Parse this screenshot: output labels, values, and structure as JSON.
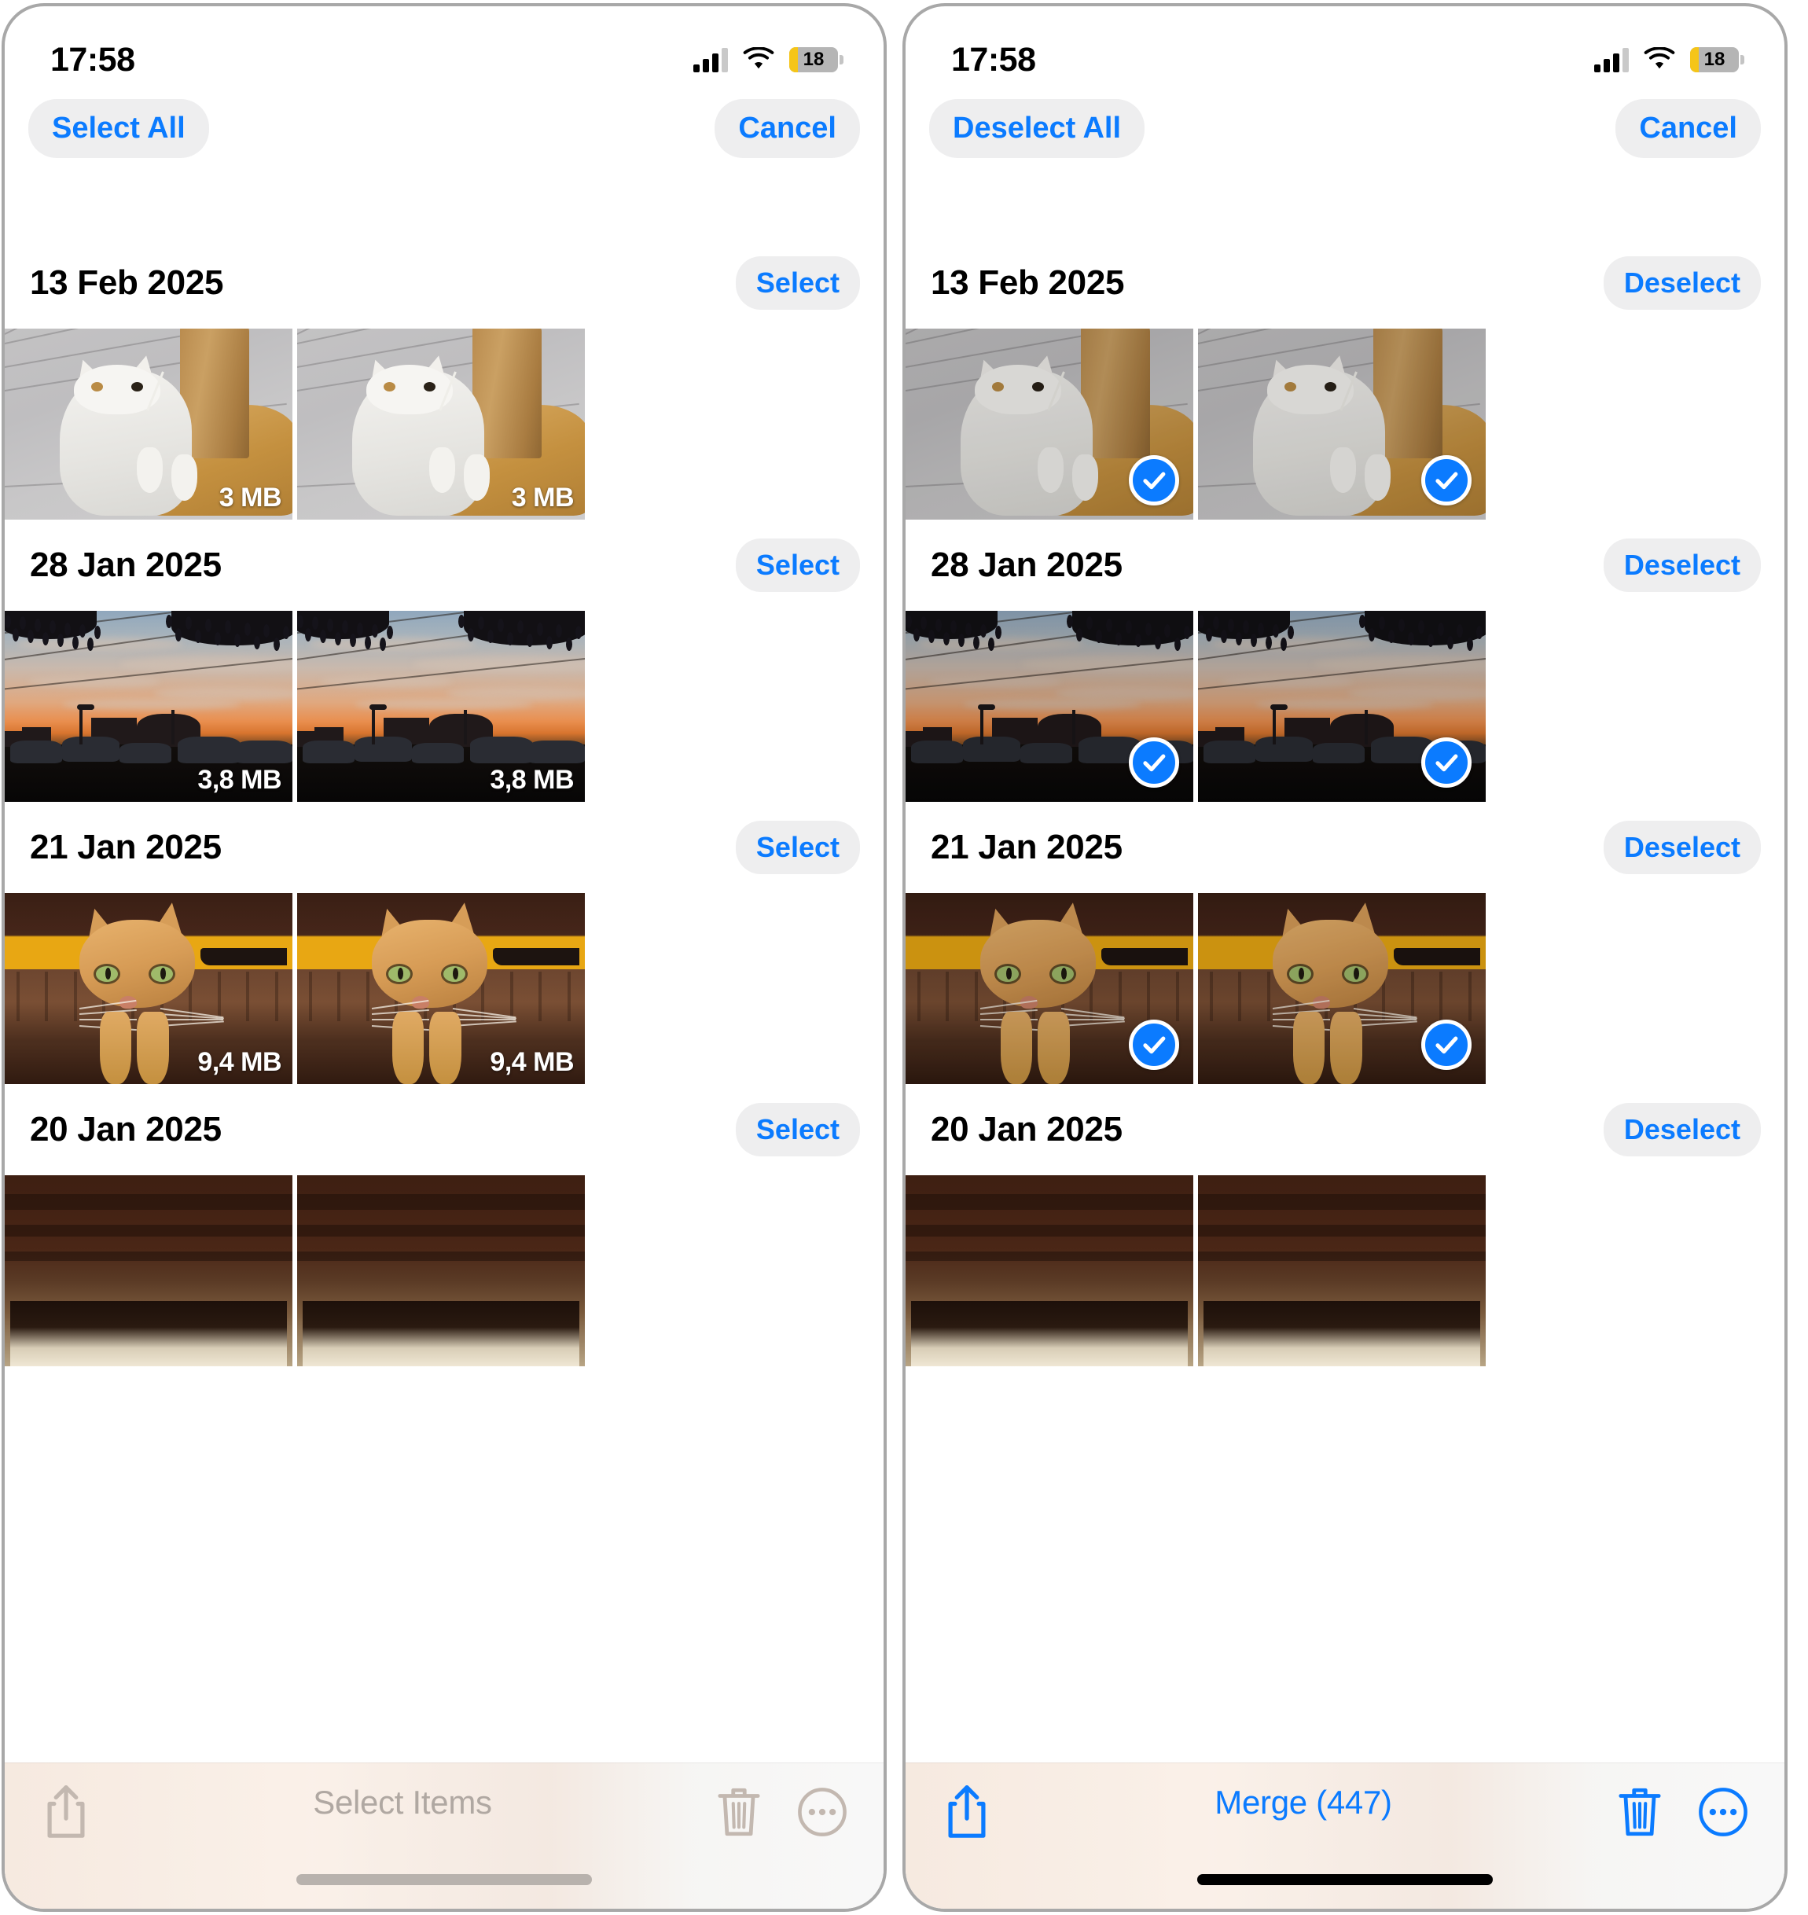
{
  "colors": {
    "accent_blue": "#0b7bff",
    "pill_bg": "#eeeeef",
    "disabled_gray": "#b0a8a2",
    "battery_yellow": "#f5c518"
  },
  "panels": [
    {
      "id": "left",
      "status": {
        "time": "17:58",
        "battery_level": "18",
        "signal_icon": "cellular-signal-icon",
        "wifi_icon": "wifi-icon",
        "battery_icon": "battery-icon"
      },
      "nav": {
        "left_button": "Select All",
        "right_button": "Cancel"
      },
      "sections": [
        {
          "date": "13 Feb 2025",
          "action_label": "Select",
          "selected": false,
          "photo": "white-kitten-on-floor",
          "items": [
            {
              "size": "3 MB",
              "selected": false
            },
            {
              "size": "3 MB",
              "selected": false
            }
          ]
        },
        {
          "date": "28 Jan 2025",
          "action_label": "Select",
          "selected": false,
          "photo": "sunset-parking-lot",
          "items": [
            {
              "size": "3,8 MB",
              "selected": false
            },
            {
              "size": "3,8 MB",
              "selected": false
            }
          ]
        },
        {
          "date": "21 Jan 2025",
          "action_label": "Select",
          "selected": false,
          "photo": "ginger-cat",
          "items": [
            {
              "size": "9,4 MB",
              "selected": false
            },
            {
              "size": "9,4 MB",
              "selected": false
            }
          ]
        },
        {
          "date": "20 Jan 2025",
          "action_label": "Select",
          "selected": false,
          "photo": "dark-wood-partial",
          "items": [
            {
              "size": "",
              "selected": false
            },
            {
              "size": "",
              "selected": false
            }
          ]
        }
      ],
      "toolbar": {
        "state": "disabled",
        "share_icon": "share-icon",
        "label": "Select Items",
        "trash_icon": "trash-icon",
        "more_icon": "more-circle-icon"
      }
    },
    {
      "id": "right",
      "status": {
        "time": "17:58",
        "battery_level": "18",
        "signal_icon": "cellular-signal-icon",
        "wifi_icon": "wifi-icon",
        "battery_icon": "battery-icon"
      },
      "nav": {
        "left_button": "Deselect All",
        "right_button": "Cancel"
      },
      "sections": [
        {
          "date": "13 Feb 2025",
          "action_label": "Deselect",
          "selected": true,
          "photo": "white-kitten-on-floor",
          "items": [
            {
              "size": "",
              "selected": true
            },
            {
              "size": "",
              "selected": true
            }
          ]
        },
        {
          "date": "28 Jan 2025",
          "action_label": "Deselect",
          "selected": true,
          "photo": "sunset-parking-lot",
          "items": [
            {
              "size": "",
              "selected": true
            },
            {
              "size": "",
              "selected": true
            }
          ]
        },
        {
          "date": "21 Jan 2025",
          "action_label": "Deselect",
          "selected": true,
          "photo": "ginger-cat",
          "items": [
            {
              "size": "",
              "selected": true
            },
            {
              "size": "",
              "selected": true
            }
          ]
        },
        {
          "date": "20 Jan 2025",
          "action_label": "Deselect",
          "selected": true,
          "photo": "dark-wood-partial",
          "items": [
            {
              "size": "",
              "selected": false
            },
            {
              "size": "",
              "selected": false
            }
          ]
        }
      ],
      "toolbar": {
        "state": "active",
        "share_icon": "share-icon",
        "label": "Merge (447)",
        "trash_icon": "trash-icon",
        "more_icon": "more-circle-icon"
      }
    }
  ]
}
